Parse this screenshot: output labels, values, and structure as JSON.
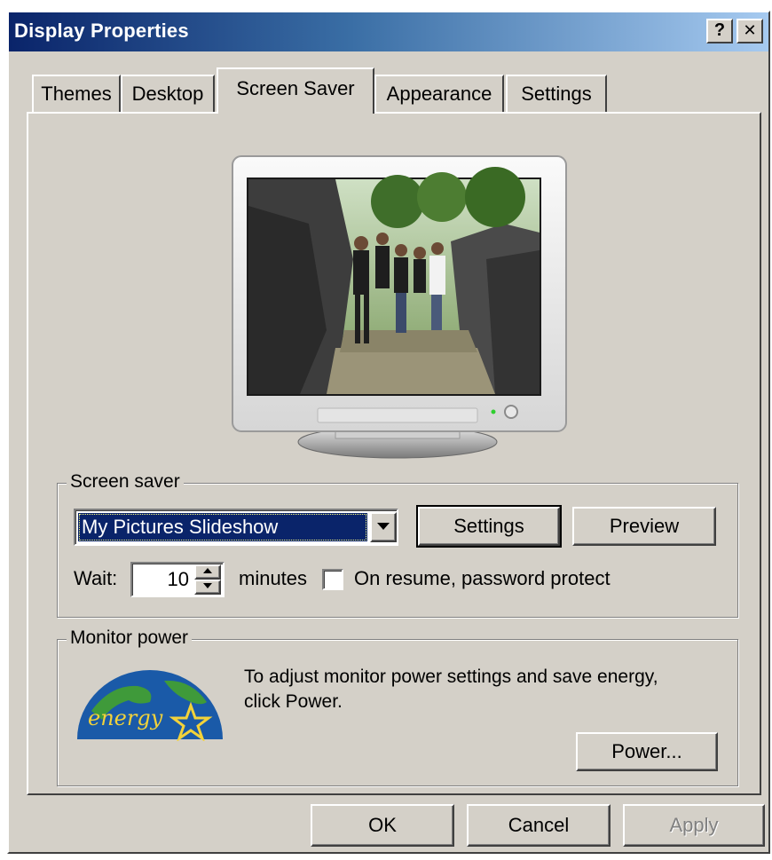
{
  "window": {
    "title": "Display Properties",
    "help_label": "?",
    "close_label": "✕"
  },
  "tabs": [
    {
      "label": "Themes"
    },
    {
      "label": "Desktop"
    },
    {
      "label": "Screen Saver",
      "active": true
    },
    {
      "label": "Appearance"
    },
    {
      "label": "Settings"
    }
  ],
  "screen_saver": {
    "group_label": "Screen saver",
    "selected": "My Pictures Slideshow",
    "settings_label": "Settings",
    "preview_label": "Preview",
    "wait_label": "Wait:",
    "wait_value": "10",
    "minutes_label": "minutes",
    "password_protect_checked": false,
    "password_protect_label": "On resume, password protect"
  },
  "monitor_power": {
    "group_label": "Monitor power",
    "description_line1": "To adjust monitor power settings and save energy,",
    "description_line2": "click Power.",
    "power_button_label": "Power...",
    "logo_text": "energy"
  },
  "dialog_buttons": {
    "ok": "OK",
    "cancel": "Cancel",
    "apply": "Apply",
    "apply_enabled": false
  },
  "colors": {
    "titlebar_start": "#0a246a",
    "titlebar_end": "#a6caf0",
    "selection": "#0a246a",
    "face": "#d4d0c8"
  }
}
